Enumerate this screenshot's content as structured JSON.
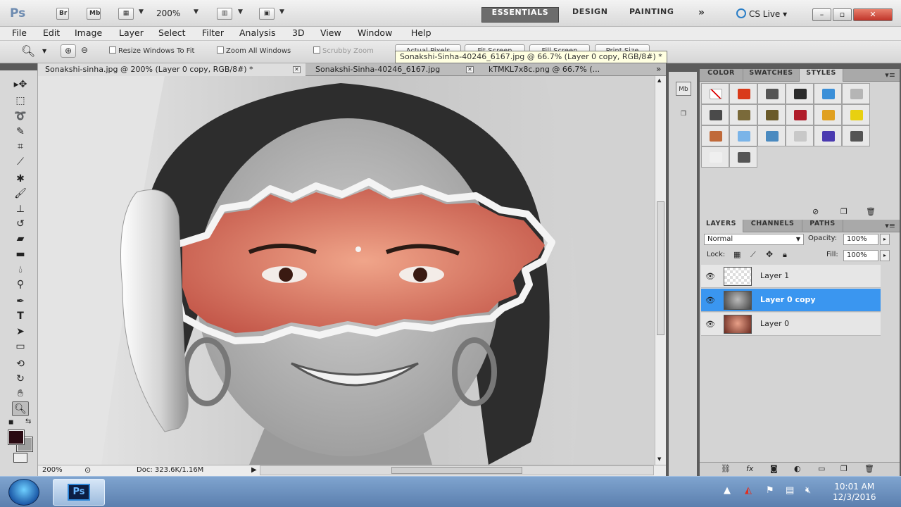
{
  "appbar": {
    "logo": "Ps",
    "bridge": "Br",
    "minibridge": "Mb",
    "zoom": "200%",
    "workspaces": [
      "ESSENTIALS",
      "DESIGN",
      "PAINTING"
    ],
    "more": "»",
    "cslive": "CS Live",
    "window_controls": {
      "minimize": "–",
      "restore": "▫",
      "close": "✕"
    }
  },
  "menu": [
    "File",
    "Edit",
    "Image",
    "Layer",
    "Select",
    "Filter",
    "Analysis",
    "3D",
    "View",
    "Window",
    "Help"
  ],
  "options": {
    "resize_windows": "Resize Windows To Fit",
    "zoom_all": "Zoom All Windows",
    "scrubby": "Scrubby Zoom",
    "actual_pixels": "Actual Pixels",
    "fit_screen": "Fit Screen",
    "fill_screen": "Fill Screen",
    "print_size": "Print Size"
  },
  "tooltip": "Sonakshi-Sinha-40246_6167.jpg @ 66.7% (Layer 0 copy, RGB/8#) *",
  "doc_tabs": [
    {
      "label": "Sonakshi-sinha.jpg @ 200% (Layer 0 copy, RGB/8#) *"
    },
    {
      "label": "Sonakshi-Sinha-40246_6167.jpg"
    },
    {
      "label": "kTMKL7x8c.png @ 66.7% (..."
    }
  ],
  "status": {
    "zoom": "200%",
    "doc": "Doc: 323.6K/1.16M"
  },
  "panels": {
    "top_tabs": [
      "COLOR",
      "SWATCHES",
      "STYLES"
    ],
    "layer_tabs": [
      "LAYERS",
      "CHANNELS",
      "PATHS"
    ],
    "blend_mode": "Normal",
    "opacity_label": "Opacity:",
    "opacity": "100%",
    "lock_label": "Lock:",
    "fill_label": "Fill:",
    "fill": "100%",
    "layers": [
      {
        "name": "Layer 1",
        "selected": false
      },
      {
        "name": "Layer 0 copy",
        "selected": true
      },
      {
        "name": "Layer 0",
        "selected": false
      }
    ],
    "style_colors": [
      "#ffffff",
      "#d93a1a",
      "#555555",
      "#2b2b2b",
      "#3a8fd8",
      "#b5b5b5",
      "#4a4a4a",
      "#7a6a3a",
      "#6a5a2a",
      "#b01c2a",
      "#e0a020",
      "#e8d010",
      "#c06a3a",
      "#7ab4e8",
      "#4a8ac0",
      "#c8c8c8",
      "#4a3ab0",
      "#555555",
      "#efefef",
      "#555555"
    ]
  },
  "taskbar": {
    "app": "Ps",
    "time": "10:01 AM",
    "date": "12/3/2016"
  }
}
